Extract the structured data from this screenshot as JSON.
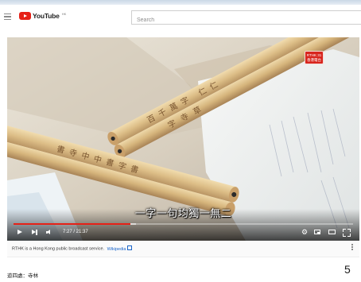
{
  "masthead": {
    "logo_text": "YouTube",
    "logo_region": "HK",
    "search": {
      "placeholder": "Search",
      "value": ""
    }
  },
  "player": {
    "channel_badge": "RTHK 31\n香港電台",
    "subtitle": "一字一句均獨一無二",
    "time_display": "7:27 / 21:37",
    "progress_fraction": 0.344,
    "buffer_fraction": 0.36,
    "pencil_texts": [
      "百千萬字 仁仁",
      "字寺草",
      "書寺中中書字書"
    ],
    "accent_color": "#e62117"
  },
  "info": {
    "text": "RTHK is a Hong Kong public broadcast service.",
    "link_text": "Wikipedia"
  },
  "video_title": "遊四處：寺林",
  "page_number": "5",
  "icons": [
    "menu-icon",
    "youtube-logo-icon",
    "play-icon",
    "next-icon",
    "volume-icon",
    "settings-icon",
    "miniplayer-icon",
    "theater-mode-icon",
    "fullscreen-icon",
    "external-link-icon",
    "more-options-icon"
  ]
}
